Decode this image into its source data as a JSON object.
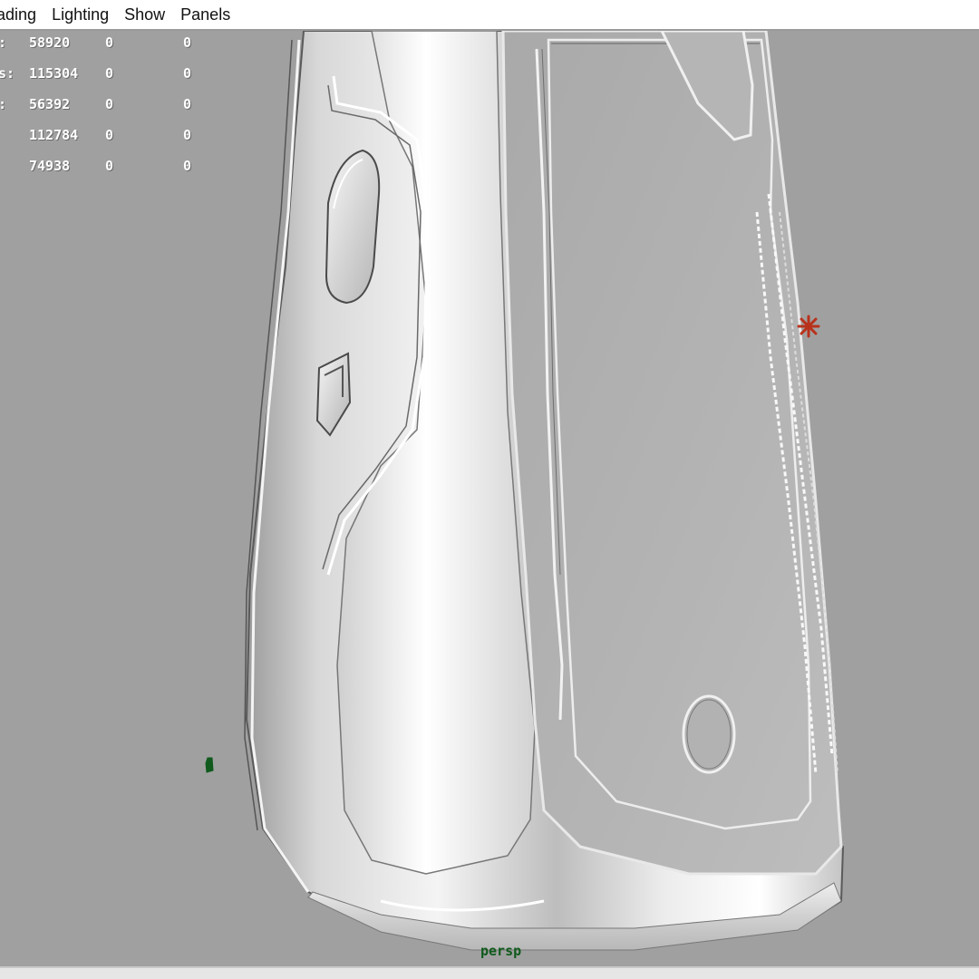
{
  "menu": {
    "items": [
      {
        "label": "nading"
      },
      {
        "label": "Lighting"
      },
      {
        "label": "Show"
      },
      {
        "label": "Panels"
      }
    ]
  },
  "hud": {
    "rows": [
      {
        "label": ":",
        "v1": "58920",
        "v2": "0",
        "v3": "0"
      },
      {
        "label": "s:",
        "v1": "115304",
        "v2": "0",
        "v3": "0"
      },
      {
        "label": ":",
        "v1": "56392",
        "v2": "0",
        "v3": "0"
      },
      {
        "label": "",
        "v1": "112784",
        "v2": "0",
        "v3": "0"
      },
      {
        "label": "",
        "v1": "74938",
        "v2": "0",
        "v3": "0"
      }
    ]
  },
  "viewport": {
    "camera_label": "persp",
    "background_color": "#a0a0a0",
    "manipulator_color": "#b8321c",
    "axis_color": "#0f5a1c"
  }
}
